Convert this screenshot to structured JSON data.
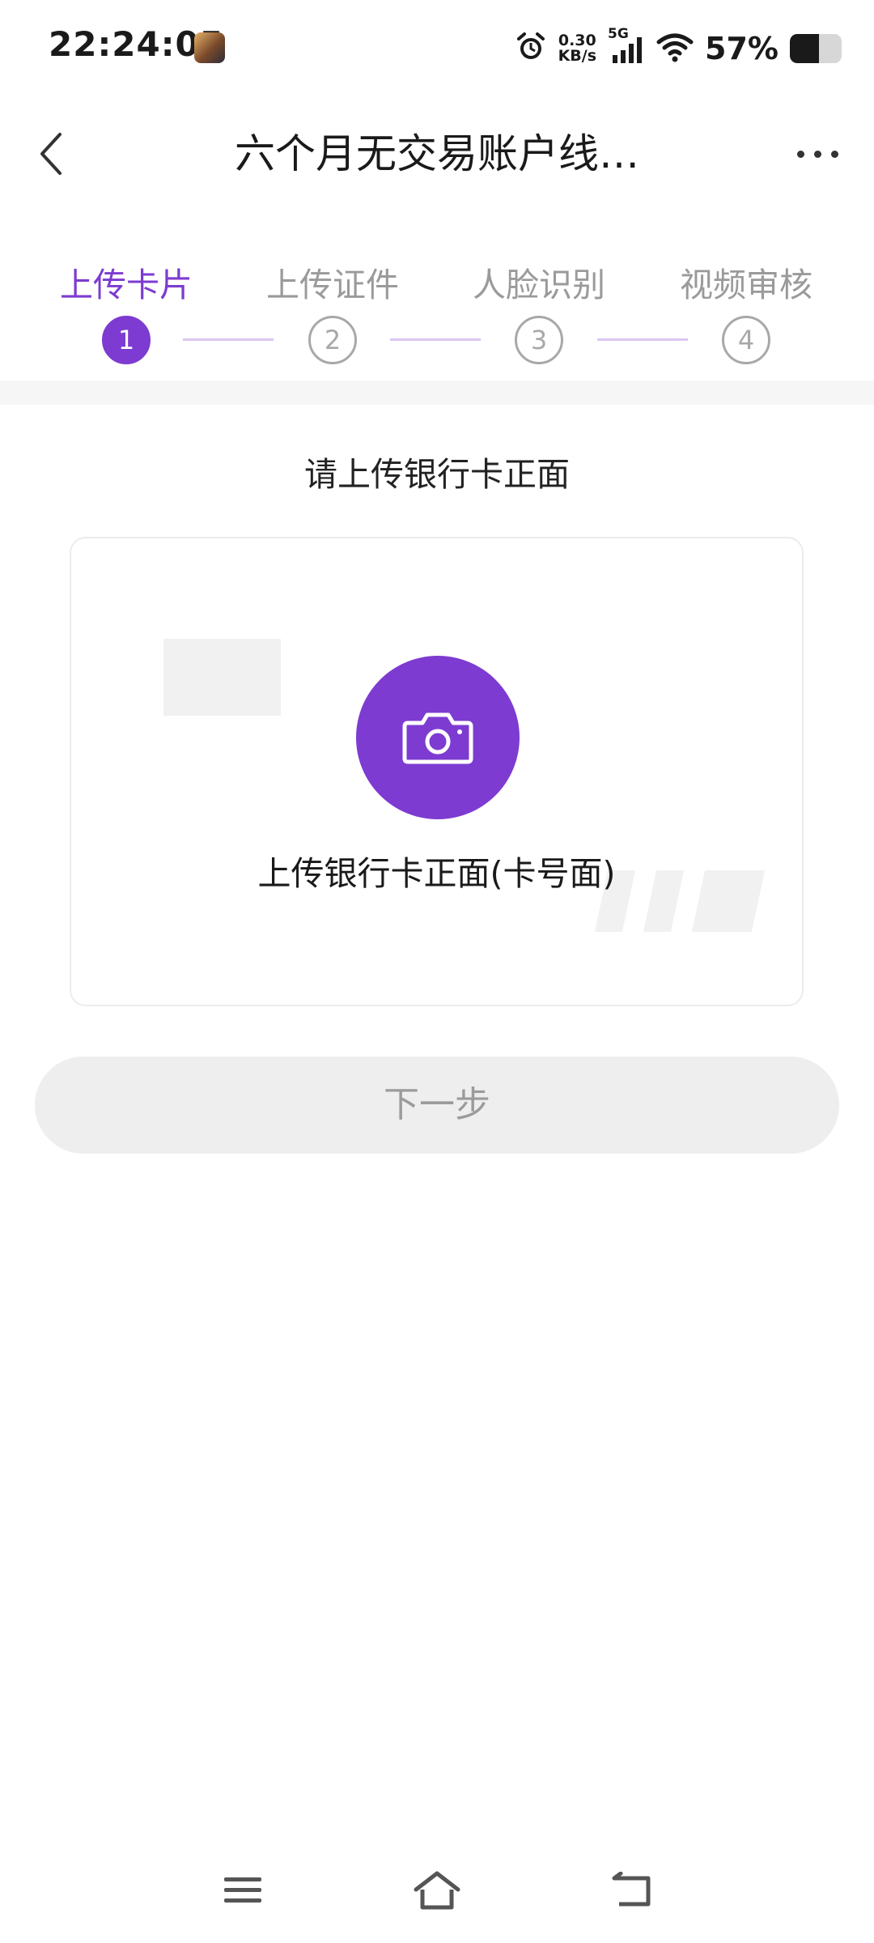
{
  "status_bar": {
    "time": "22:24:05",
    "app_icon": "game-avatar-icon",
    "alarm_icon": "alarm-clock-icon",
    "speed_value": "0.30",
    "speed_unit": "KB/s",
    "network": "5G",
    "signal_icon": "cell-signal-icon",
    "wifi_icon": "wifi-icon",
    "battery_percent": "57%",
    "battery_level": 0.57
  },
  "header": {
    "title": "六个月无交易账户线…",
    "back_icon": "chevron-left-icon",
    "more_icon": "more-dots-icon"
  },
  "steps": [
    {
      "label": "上传卡片",
      "number": "1",
      "active": true
    },
    {
      "label": "上传证件",
      "number": "2",
      "active": false
    },
    {
      "label": "人脸识别",
      "number": "3",
      "active": false
    },
    {
      "label": "视频审核",
      "number": "4",
      "active": false
    }
  ],
  "main": {
    "section_title": "请上传银行卡正面",
    "upload_label": "上传银行卡正面(卡号面)",
    "camera_icon": "camera-icon",
    "next_button": "下一步"
  },
  "nav_bar": {
    "menu_icon": "menu-icon",
    "home_icon": "home-icon",
    "back_icon": "back-arrow-icon"
  },
  "colors": {
    "accent": "#7d3bd1",
    "inactive": "#9a9a9a",
    "button_bg": "#eeeeee",
    "button_text": "#9b9b9b"
  }
}
